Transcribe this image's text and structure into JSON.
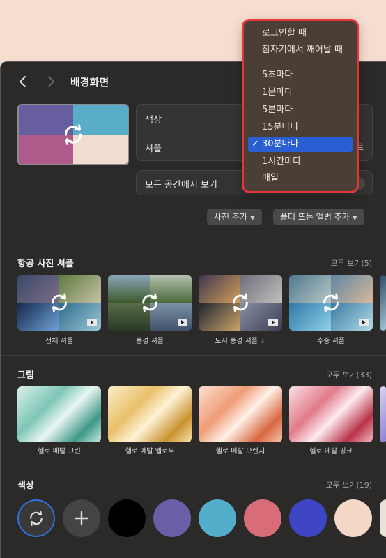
{
  "window": {
    "title": "배경화면",
    "back_icon": "chevron-left-icon",
    "forward_icon": "chevron-right-icon"
  },
  "preview": {
    "colors": [
      "#675e9f",
      "#5aadc9",
      "#b05a8c",
      "#f0ddd0"
    ],
    "icon": "shuffle-rotate-icon"
  },
  "settings": {
    "color_label": "색상",
    "shuffle_label": "셔플",
    "shuffle_value_partial": "로",
    "all_spaces_label": "모든 공간에서 보기",
    "all_spaces_on": false
  },
  "buttons": {
    "add_photo": "사진 추가",
    "add_folder_album": "폴더 또는 앨범 추가"
  },
  "aerial": {
    "title": "항공 사진 셔플",
    "see_all": "모두 보기(5)",
    "items": [
      {
        "label": "전체 셔플"
      },
      {
        "label": "풍경 셔플"
      },
      {
        "label": "도시 풍경 셔플 ↓"
      },
      {
        "label": "수중 셔플"
      }
    ]
  },
  "pictures": {
    "title": "그림",
    "see_all": "모두 보기(33)",
    "items": [
      {
        "label": "헬로 메탈 그린",
        "colors": [
          "#bfe6dc",
          "#4ea898"
        ]
      },
      {
        "label": "헬로 메탈 옐로우",
        "colors": [
          "#f7dfa1",
          "#d6a441"
        ]
      },
      {
        "label": "헬로 메탈 오렌지",
        "colors": [
          "#f8cdb7",
          "#e07a55"
        ]
      },
      {
        "label": "헬로 메탈 핑크",
        "colors": [
          "#f6c7cd",
          "#c8475a"
        ]
      }
    ]
  },
  "colors": {
    "title": "색상",
    "see_all": "모두 보기(19)",
    "swatches": [
      "#000000",
      "#6a5fa6",
      "#52aecb",
      "#d86d78",
      "#3f46c6",
      "#f3d8c6"
    ]
  },
  "menu": {
    "items_top": [
      "로그인할 때",
      "잠자기에서 깨어날 때"
    ],
    "items_interval": [
      "5초마다",
      "1분마다",
      "5분마다",
      "15분마다",
      "30분마다",
      "1시간마다",
      "매일"
    ],
    "selected": "30분마다",
    "check": "✓"
  }
}
